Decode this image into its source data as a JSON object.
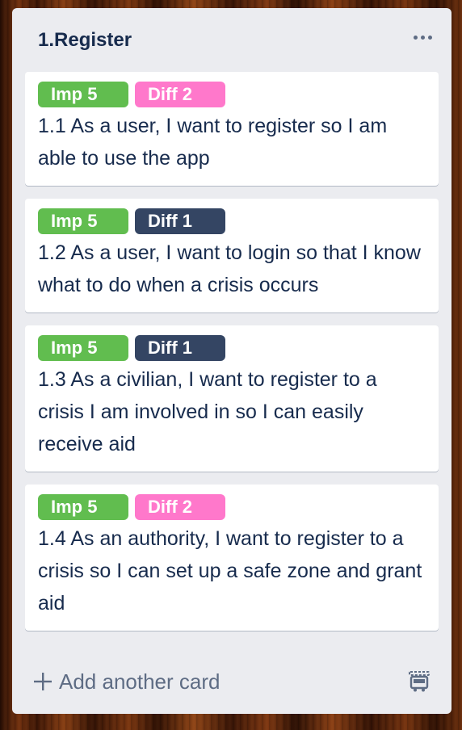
{
  "list": {
    "title": "1.Register",
    "menu_icon": "ellipsis-icon"
  },
  "colors": {
    "green": "#61bd4f",
    "pink": "#ff78cb",
    "navy": "#344563"
  },
  "cards": [
    {
      "labels": [
        {
          "text": "Imp 5",
          "color": "#61bd4f"
        },
        {
          "text": "Diff 2",
          "color": "#ff78cb"
        }
      ],
      "text": "1.1 As a user, I want to register so I am able to use the app"
    },
    {
      "labels": [
        {
          "text": "Imp 5",
          "color": "#61bd4f"
        },
        {
          "text": "Diff 1",
          "color": "#344563"
        }
      ],
      "text": "1.2 As a user, I want to login so that I know what to do when a crisis occurs"
    },
    {
      "labels": [
        {
          "text": "Imp 5",
          "color": "#61bd4f"
        },
        {
          "text": "Diff 1",
          "color": "#344563"
        }
      ],
      "text": "1.3 As a civilian, I want to register to a crisis I am involved in so I can easily receive aid"
    },
    {
      "labels": [
        {
          "text": "Imp 5",
          "color": "#61bd4f"
        },
        {
          "text": "Diff 2",
          "color": "#ff78cb"
        }
      ],
      "text": "1.4 As an authority, I want to register to a crisis so I can set up a safe zone and grant aid"
    }
  ],
  "composer": {
    "add_label": "Add another card",
    "add_icon": "plus-icon",
    "template_icon": "card-template-icon"
  }
}
